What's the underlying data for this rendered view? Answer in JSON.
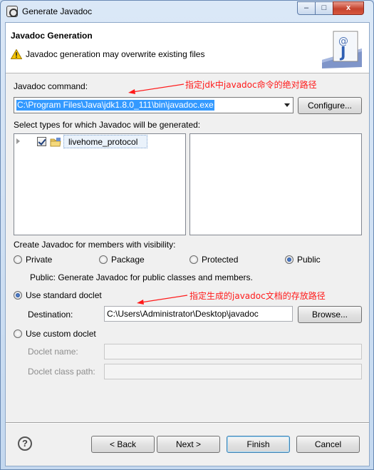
{
  "window": {
    "title": "Generate Javadoc",
    "minimize_glyph": "–",
    "maximize_glyph": "□",
    "close_glyph": "x"
  },
  "banner": {
    "title": "Javadoc Generation",
    "message": "Javadoc generation may overwrite existing files",
    "icon": "javadoc-wizard-icon"
  },
  "javadoc_command": {
    "label": "Javadoc command:",
    "value": "C:\\Program Files\\Java\\jdk1.8.0_111\\bin\\javadoc.exe",
    "configure_label": "Configure..."
  },
  "types": {
    "label": "Select types for which Javadoc will be generated:",
    "tree_items": [
      {
        "label": "livehome_protocol",
        "checked": true
      }
    ]
  },
  "visibility": {
    "label": "Create Javadoc for members with visibility:",
    "options": [
      "Private",
      "Package",
      "Protected",
      "Public"
    ],
    "selected": "Public",
    "description": "Public: Generate Javadoc for public classes and members."
  },
  "standard_doclet": {
    "label": "Use standard doclet",
    "destination_label": "Destination:",
    "destination_value": "C:\\Users\\Administrator\\Desktop\\javadoc",
    "browse_label": "Browse..."
  },
  "custom_doclet": {
    "label": "Use custom doclet",
    "name_label": "Doclet name:",
    "class_path_label": "Doclet class path:"
  },
  "annotations": {
    "command_note": "指定jdk中javadoc命令的绝对路径",
    "destination_note": "指定生成的javadoc文档的存放路径"
  },
  "footer": {
    "help_glyph": "?",
    "back_label": "< Back",
    "next_label": "Next >",
    "finish_label": "Finish",
    "cancel_label": "Cancel"
  },
  "colors": {
    "annotation": "#ff1a1a",
    "selection": "#3399ff"
  }
}
